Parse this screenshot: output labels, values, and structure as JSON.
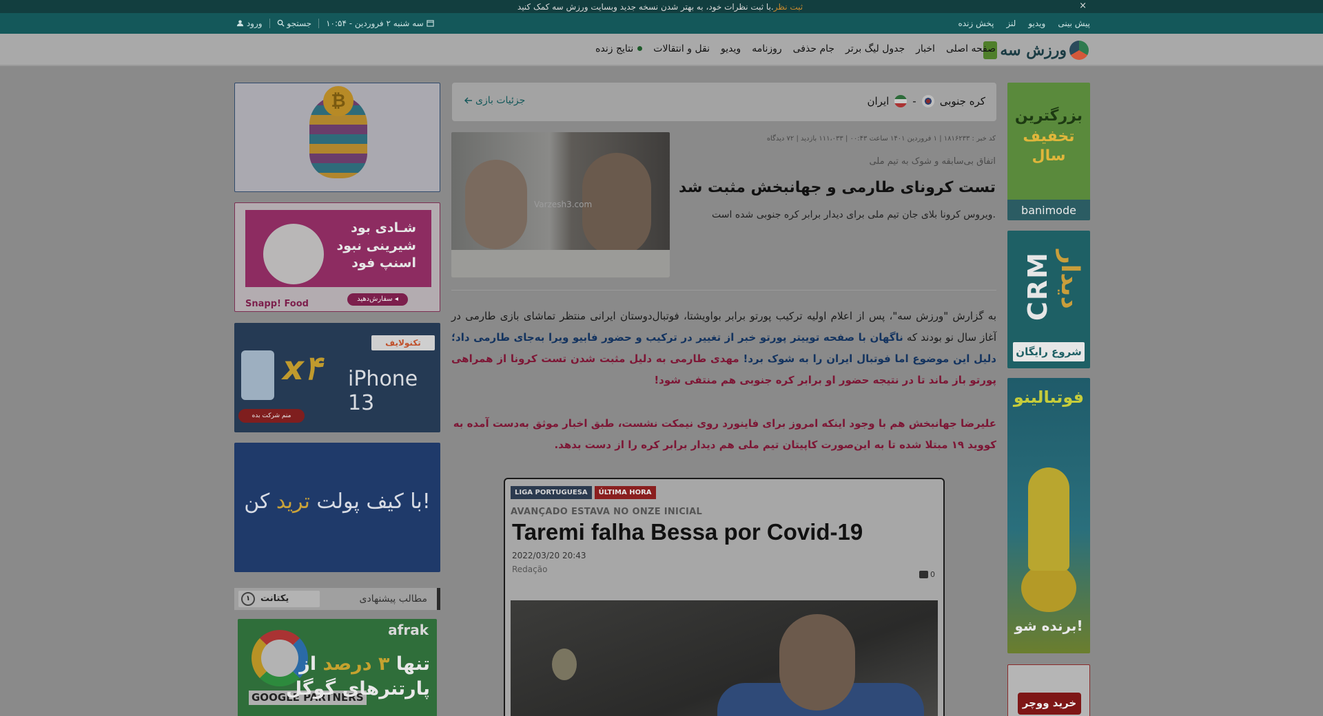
{
  "notice": {
    "text": "با ثبت نظرات خود، به بهتر شدن نسخه جدید وبسایت ورزش سه کمک کنید.",
    "cta": "ثبت نظر",
    "close": "×"
  },
  "utilbar": {
    "links": [
      "پیش بینی",
      "ویدیو",
      "لنز",
      "پخش زنده"
    ],
    "date": "سه شنبه ۲ فروردین - ۱۰:۵۴",
    "search": "جستجو",
    "login": "ورود"
  },
  "nav": {
    "logo_text": "ورزش سه",
    "items": [
      "صفحه اصلی",
      "اخبار",
      "جدول لیگ برتر",
      "جام حذفی",
      "روزنامه",
      "ویدیو",
      "نقل و انتقالات",
      "نتایج زنده"
    ]
  },
  "match": {
    "home": "کره جنوبی",
    "away": "ایران",
    "separator": "-",
    "details": "جزئیات بازی"
  },
  "article": {
    "meta": "کد خبر : ۱۸۱۶۲۳۳ | ۱ فروردین ۱۴۰۱ ساعت ۰۰:۴۳ | ۱۱۱،۰۳۳ بازدید | ۷۲ دیدگاه",
    "subtitle": "اتفاق بی‌سابقه و شوک به تیم ملی",
    "headline": "تست کرونای طارمی و جهانبخش مثبت شد",
    "lead": "ویروس کرونا بلای جان تیم ملی برای دیدار برابر کره جنوبی شده است.",
    "image_watermark": "Varzesh3.com",
    "p1_plain": "به گزارش \"ورزش سه\"، پس از اعلام اولیه ترکیب پورتو برابر بواویشتا، فوتبال‌دوستان ایرانی منتظر تماشای بازی طارمی در آغاز سال نو بودند که ",
    "p1_blue": "ناگهان با صفحه توییتر پورتو خبر از تغییر در ترکیب و حضور فابیو ویرا به‌جای طارمی داد؛ دلیل این موضوع اما فوتبال ایران را به شوک برد!",
    "p1_red": " مهدی طارمی به دلیل مثبت شدن تست کرونا از همراهی پورتو باز ماند تا در نتیجه حضور او برابر کره جنوبی هم منتفی شود!",
    "p2": "علیرضا جهانبخش هم با وجود اینکه امروز برای فاینورد روی نیمکت نشست، طبق اخبار موثق به‌دست آمده به کووید ۱۹ مبتلا شده تا به این‌صورت کاپیتان تیم ملی هم دیدار برابر کره را از دست بدهد."
  },
  "embed": {
    "tag1": "LIGA PORTUGUESA",
    "tag2": "ÚLTIMA HORA",
    "kicker": "AVANÇADO ESTAVA NO ONZE INICIAL",
    "title": "Taremi falha Bessa por Covid-19",
    "date": "2022/03/20 20:43",
    "author": "Redação",
    "comments": "0"
  },
  "ads_right": {
    "banimode_line1": "بزرگترین",
    "banimode_line2": "تخفیف",
    "banimode_line3": "سال",
    "banimode_brand": "banimode",
    "crm_word": "CRM",
    "crm_fa": "دیدار",
    "crm_cta": "شروع رایگان",
    "footballino_title": "فوتبالینو",
    "footballino_cta": "برنده شو!",
    "voucher_cta": "خرید ووچر"
  },
  "ads_left": {
    "crypto_coin": "₿",
    "snapp_line1": "شـادی بود",
    "snapp_line2": "شیرینی نبود",
    "snapp_line3": "اسنپ فود",
    "snapp_brand": "Snapp! Food",
    "snapp_cta": "سفارش‌دهید ◂",
    "techno_brand": "تکنولایف",
    "techno_x": "x۴",
    "techno_model": "iPhone 13",
    "techno_cta": "منم شرکت بده",
    "wallet_text_1": "با کیف پولت ",
    "wallet_text_hl": "ترید",
    "wallet_text_2": " کن!",
    "afrak_brand": "afrak",
    "afrak_gp": "GOOGLE PARTNERS",
    "afrak_line1_a": "تنها ",
    "afrak_line1_hl": "۳ درصد",
    "afrak_line1_b": " از",
    "afrak_line2": "پارتنرهای گوگل"
  },
  "recommended": {
    "label": "مطالب پیشنهادی",
    "provider": "یکتانت",
    "provider_ring": "۱"
  }
}
